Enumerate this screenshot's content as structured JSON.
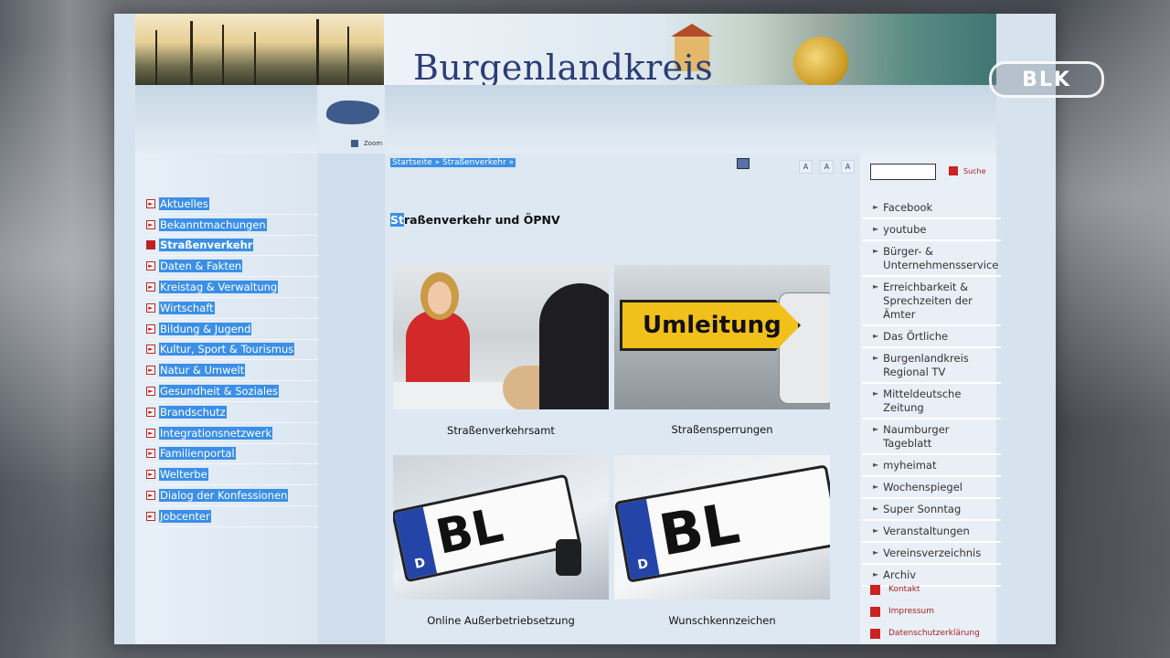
{
  "header": {
    "site_title": "Burgenlandkreis",
    "zoom_label": "Zoom"
  },
  "tv_bug": "BLK",
  "breadcrumb": "Startseite » Straßenverkehr »",
  "font_sizes": [
    "A",
    "A",
    "A"
  ],
  "left_nav": {
    "items": [
      {
        "label": "Aktuelles"
      },
      {
        "label": "Bekanntmachungen"
      },
      {
        "label": "Straßenverkehr",
        "active": true
      },
      {
        "label": "Daten & Fakten"
      },
      {
        "label": "Kreistag & Verwaltung"
      },
      {
        "label": "Wirtschaft"
      },
      {
        "label": "Bildung & Jugend"
      },
      {
        "label": "Kultur, Sport & Tourismus"
      },
      {
        "label": "Natur & Umwelt"
      },
      {
        "label": "Gesundheit & Soziales"
      },
      {
        "label": "Brandschutz"
      },
      {
        "label": "Integrationsnetzwerk"
      },
      {
        "label": "Familienportal"
      },
      {
        "label": "Welterbe"
      },
      {
        "label": "Dialog der Konfessionen"
      },
      {
        "label": "Jobcenter"
      }
    ]
  },
  "main": {
    "heading_first": "St",
    "heading_rest": "raßenverkehr und ÖPNV",
    "tiles": [
      {
        "caption": "Straßenverkehrsamt"
      },
      {
        "caption": "Straßensperrungen",
        "sign_text": "Umleitung"
      },
      {
        "caption": "Online Außerbetriebsetzung",
        "plate_text": "BL",
        "plate_country": "D"
      },
      {
        "caption": "Wunschkennzeichen",
        "plate_text": "BL",
        "plate_country": "D"
      }
    ]
  },
  "search": {
    "button_label": "Suche"
  },
  "right_links": [
    "Facebook",
    "youtube",
    "Bürger- & Unternehmensservice",
    "Erreichbarkeit & Sprechzeiten der Ämter",
    "Das Örtliche",
    "Burgenlandkreis Regional TV",
    "Mitteldeutsche Zeitung",
    "Naumburger Tageblatt",
    "myheimat",
    "Wochenspiegel",
    "Super Sonntag",
    "Veranstaltungen",
    "Vereinsverzeichnis",
    "Archiv"
  ],
  "footer_links": [
    "Kontakt",
    "Impressum",
    "Datenschutzerklärung"
  ]
}
